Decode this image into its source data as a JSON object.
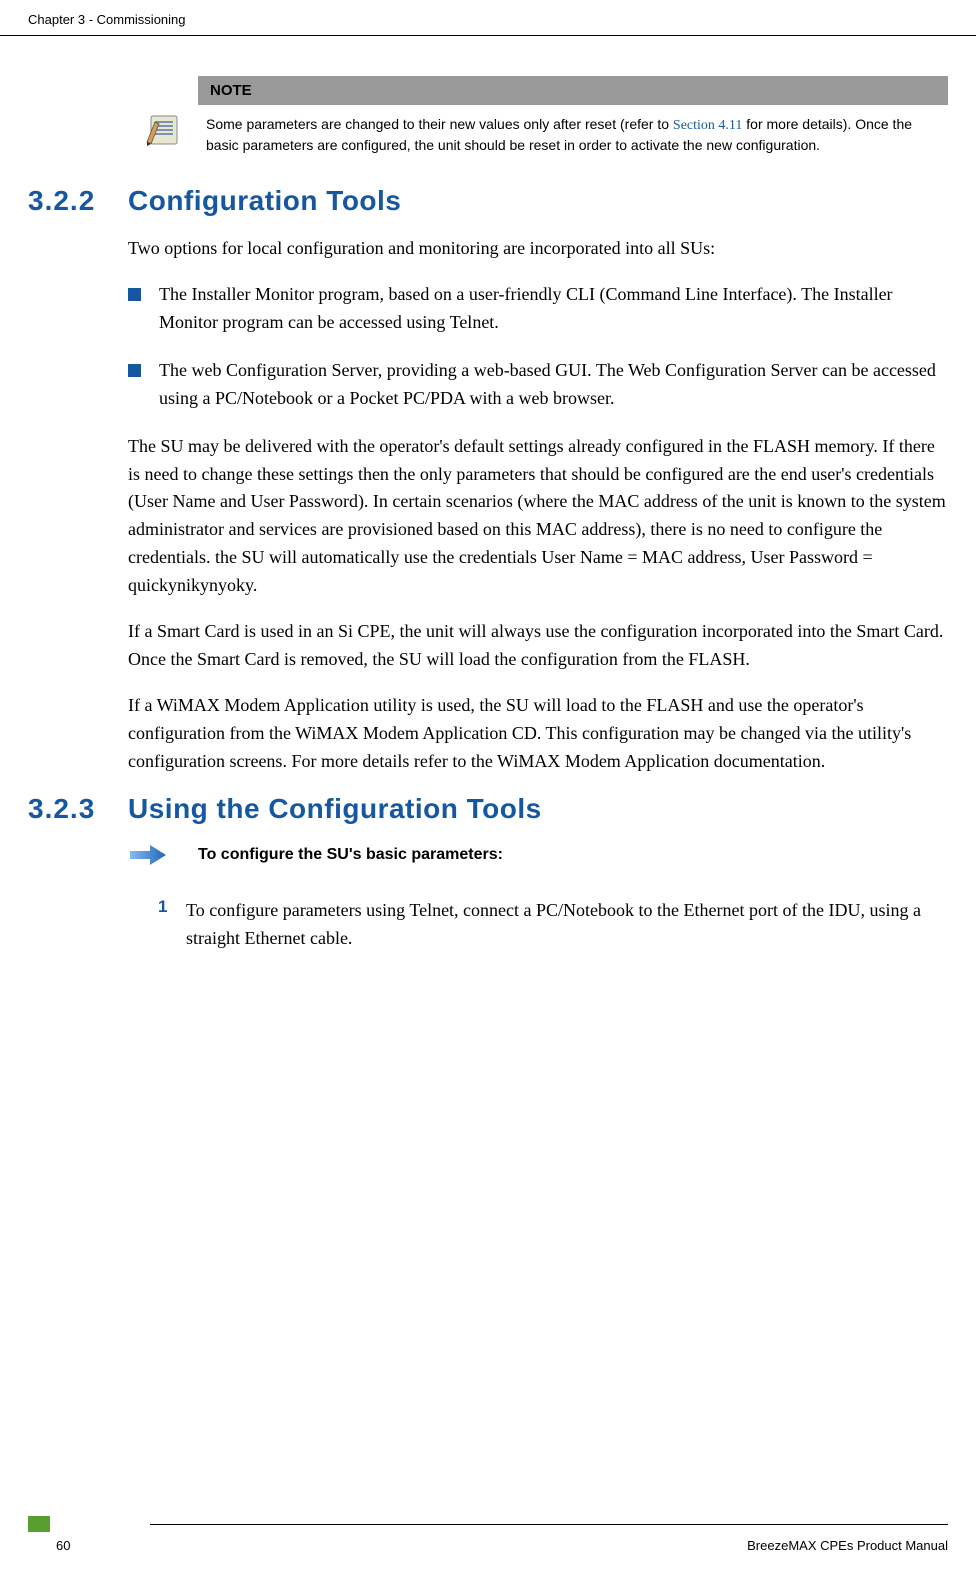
{
  "header": {
    "chapter": "Chapter 3 - Commissioning"
  },
  "note": {
    "label": "NOTE",
    "text_before": "Some parameters are changed to their new values only after reset (refer to ",
    "section_ref": "Section 4.11",
    "text_after": " for more details). Once the basic parameters are configured, the unit should be reset in order to activate the new configuration."
  },
  "section_322": {
    "number": "3.2.2",
    "title": "Configuration Tools",
    "intro": "Two options for local configuration and monitoring are incorporated into all SUs:",
    "bullets": [
      "The Installer Monitor program, based on a user-friendly CLI (Command Line Interface). The Installer Monitor program can be accessed using Telnet.",
      "The web Configuration Server, providing a web-based GUI. The Web Configuration Server can be accessed using a PC/Notebook or a Pocket PC/PDA with a web browser."
    ],
    "para1": "The SU may be delivered with the operator's default settings already configured in the FLASH memory. If there is need to change these settings then the only parameters that should be configured are the end user's credentials (User Name and User Password). In certain scenarios (where the MAC address of the unit is known to the system administrator and services are provisioned based on this MAC address), there is no need to configure the credentials. the SU will automatically use the credentials User Name = MAC address, User Password = quickynikynyoky.",
    "para2": "If a Smart Card is used in an Si CPE, the unit will always use the configuration incorporated into the Smart Card. Once the Smart Card is removed, the SU will load the configuration from the FLASH.",
    "para3": "If a WiMAX Modem Application utility is used, the SU will load to the FLASH and use the operator's configuration from the WiMAX Modem Application CD. This configuration may be changed via the utility's configuration screens. For more details refer to the WiMAX Modem Application documentation."
  },
  "section_323": {
    "number": "3.2.3",
    "title": "Using the Configuration Tools",
    "procedure_title": "To configure the SU's basic parameters:",
    "steps": [
      {
        "num": "1",
        "text": "To configure parameters using Telnet, connect a PC/Notebook to the Ethernet port of the IDU, using a straight Ethernet cable."
      }
    ]
  },
  "footer": {
    "page": "60",
    "title": "BreezeMAX CPEs Product Manual"
  }
}
